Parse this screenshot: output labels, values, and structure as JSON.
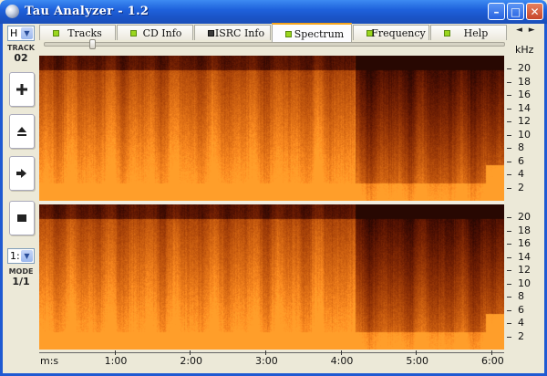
{
  "window": {
    "title": "Tau Analyzer - 1.2",
    "minimize_glyph": "–",
    "maximize_glyph": "□",
    "close_glyph": "✕"
  },
  "left_panel": {
    "channel_select": "H",
    "track_label": "TRACK",
    "track_number": "02",
    "buttons": [
      {
        "name": "plus-icon"
      },
      {
        "name": "eject-icon"
      },
      {
        "name": "play-icon"
      },
      {
        "name": "stop-icon"
      }
    ],
    "mode_select": "1:",
    "mode_label": "MODE",
    "mode_value": "1/1",
    "dropdown_glyph": "▼"
  },
  "tabs": [
    {
      "label": "Tracks",
      "active": false,
      "indicator": "green"
    },
    {
      "label": "CD Info",
      "active": false,
      "indicator": "green"
    },
    {
      "label": "ISRC Info",
      "active": false,
      "indicator": "dark"
    },
    {
      "label": "Spectrum",
      "active": true,
      "indicator": "green"
    },
    {
      "label": "Frequency",
      "active": false,
      "indicator": "green"
    },
    {
      "label": "Help",
      "active": false,
      "indicator": "green"
    }
  ],
  "tab_nav": {
    "left": "◄",
    "right": "►"
  },
  "spectrum": {
    "y_unit": "kHz",
    "y_ticks": [
      "20",
      "18",
      "16",
      "14",
      "12",
      "10",
      "8",
      "6",
      "4",
      "2"
    ],
    "x_ticks": [
      "m:s",
      "1:00",
      "2:00",
      "3:00",
      "4:00",
      "5:00",
      "6:00"
    ],
    "slider_position": 0.1,
    "colors": {
      "hot": "#f07a14",
      "mid": "#c04a06",
      "dark": "#3a0c00"
    }
  }
}
